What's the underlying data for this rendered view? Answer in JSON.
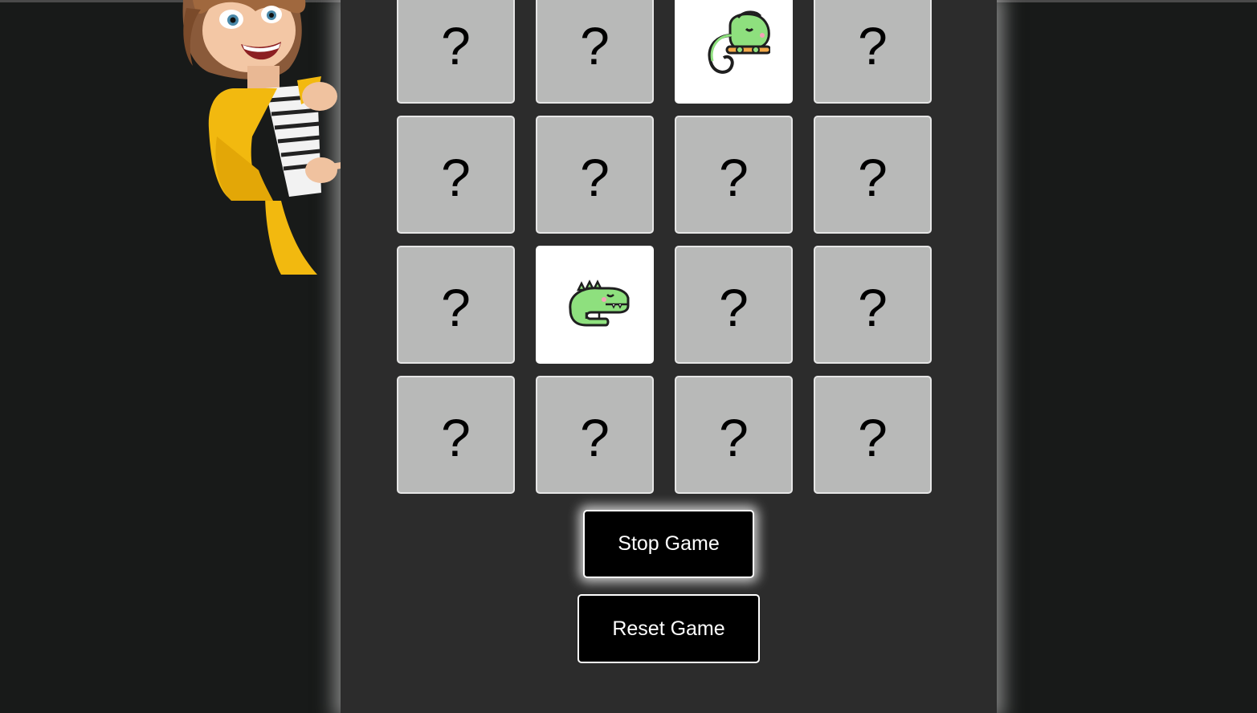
{
  "board": {
    "cards": [
      {
        "state": "hidden",
        "label": "?"
      },
      {
        "state": "hidden",
        "label": "?"
      },
      {
        "state": "revealed",
        "icon": "chameleon-icon"
      },
      {
        "state": "hidden",
        "label": "?"
      },
      {
        "state": "hidden",
        "label": "?"
      },
      {
        "state": "hidden",
        "label": "?"
      },
      {
        "state": "hidden",
        "label": "?"
      },
      {
        "state": "hidden",
        "label": "?"
      },
      {
        "state": "hidden",
        "label": "?"
      },
      {
        "state": "revealed",
        "icon": "crocodile-icon"
      },
      {
        "state": "hidden",
        "label": "?"
      },
      {
        "state": "hidden",
        "label": "?"
      },
      {
        "state": "hidden",
        "label": "?"
      },
      {
        "state": "hidden",
        "label": "?"
      },
      {
        "state": "hidden",
        "label": "?"
      },
      {
        "state": "hidden",
        "label": "?"
      }
    ]
  },
  "controls": {
    "stop_label": "Stop Game",
    "reset_label": "Reset Game"
  },
  "decor": {
    "character": "cartoon-woman-yellow-jacket"
  },
  "colors": {
    "page_bg": "#181a19",
    "panel_bg": "#2c2c2c",
    "card_back": "#b8b9b8",
    "card_face": "#ffffff",
    "button_bg": "#000000",
    "creature_green": "#7fd67a"
  }
}
